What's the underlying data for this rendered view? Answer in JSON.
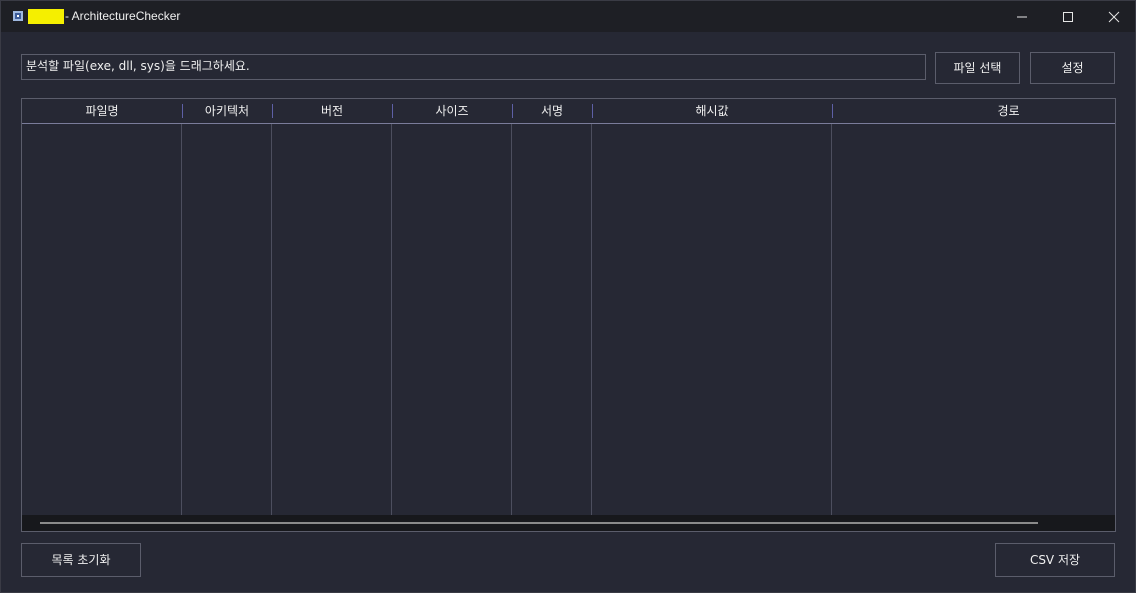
{
  "window": {
    "title": "- ArchitectureChecker",
    "accent": "#f5ef00"
  },
  "dropzone": {
    "text": "분석할 파일(exe, dll, sys)을 드래그하세요."
  },
  "toolbar": {
    "file_select_label": "파일 선택",
    "settings_label": "설정"
  },
  "table": {
    "columns": [
      "파일명",
      "아키텍처",
      "버전",
      "사이즈",
      "서명",
      "해시값",
      "경로"
    ],
    "rows": []
  },
  "footer": {
    "reset_label": "목록 초기화",
    "csv_label": "CSV 저장"
  }
}
